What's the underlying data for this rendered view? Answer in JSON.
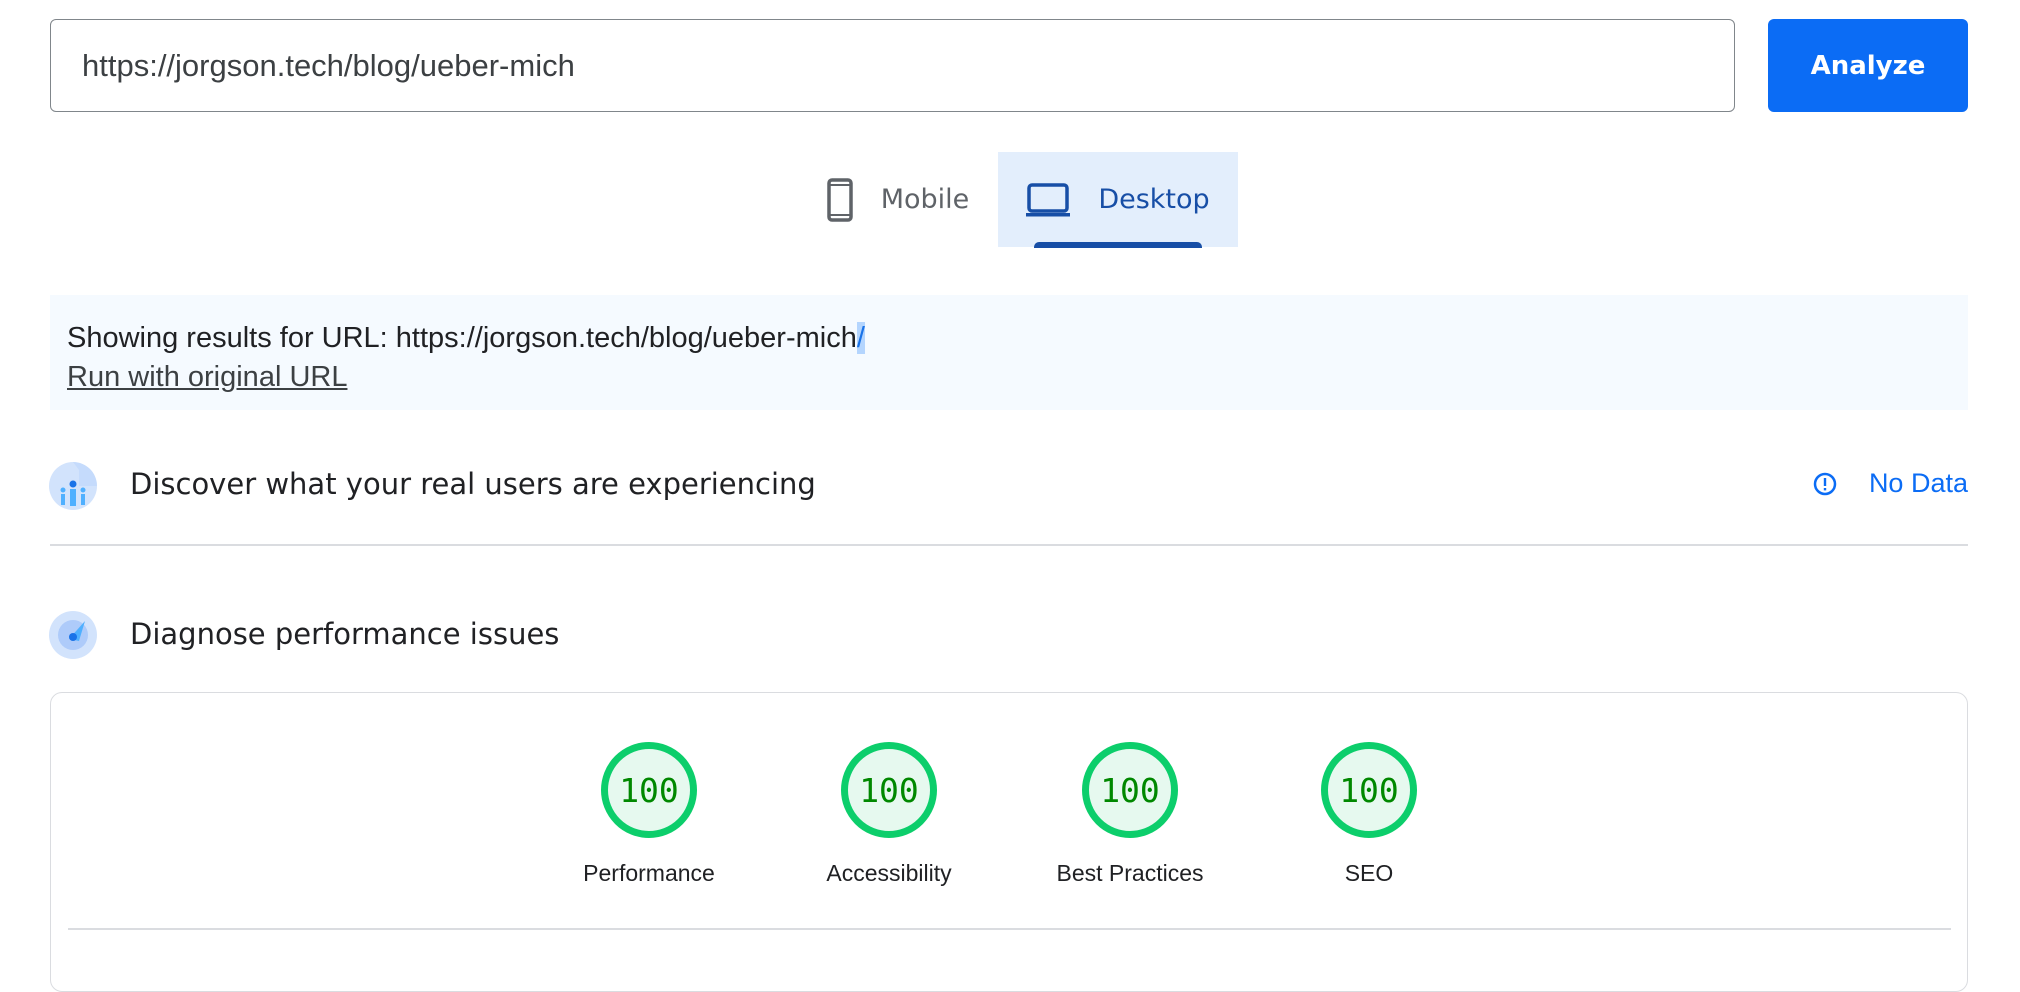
{
  "search": {
    "url_value": "https://jorgson.tech/blog/ueber-mich",
    "analyze_label": "Analyze"
  },
  "tabs": [
    {
      "label": "Mobile",
      "icon": "smartphone-icon",
      "selected": false
    },
    {
      "label": "Desktop",
      "icon": "laptop-icon",
      "selected": true
    }
  ],
  "info": {
    "prefix": "Showing results for URL: https://jorgson.tech/blog/ueber-mich",
    "selected_suffix": "/",
    "run_original_link": "Run with original URL"
  },
  "sections": {
    "field_data": {
      "title": "Discover what your real users are experiencing",
      "status": "No Data",
      "status_icon": "alert-circle-icon"
    },
    "lab_data": {
      "title": "Diagnose performance issues"
    }
  },
  "scores": [
    {
      "label": "Performance",
      "value": "100"
    },
    {
      "label": "Accessibility",
      "value": "100"
    },
    {
      "label": "Best Practices",
      "value": "100"
    },
    {
      "label": "SEO",
      "value": "100"
    }
  ],
  "colors": {
    "accent": "#0b6cf5",
    "tab_active": "#174ea6",
    "score_good": "#0cce6b",
    "score_text": "#008800"
  }
}
